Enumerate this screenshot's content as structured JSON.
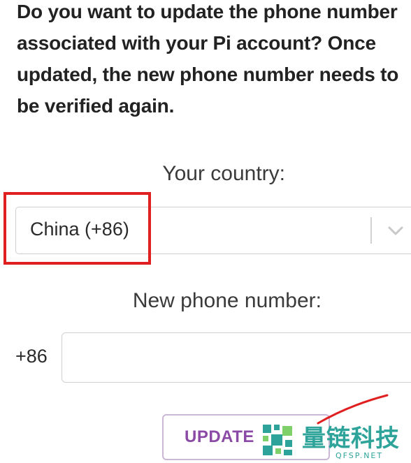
{
  "intro": {
    "text": "Do you want to update the phone number associated with your Pi account? Once updated, the new phone number needs to be verified again."
  },
  "country": {
    "label": "Your country:",
    "selected": "China (+86)"
  },
  "phone": {
    "label": "New phone number:",
    "prefix": "+86",
    "value": "",
    "placeholder": ""
  },
  "actions": {
    "update_label": "UPDATE"
  },
  "watermark": {
    "text": "量链科技",
    "sub": "QFSP.NET"
  },
  "colors": {
    "highlight": "#e02020",
    "button_text": "#8a4aa6",
    "watermark": "#2ea39a"
  },
  "icons": {
    "select_toggle": "chevron-down-icon",
    "watermark_logo": "pixel-logo-icon"
  }
}
